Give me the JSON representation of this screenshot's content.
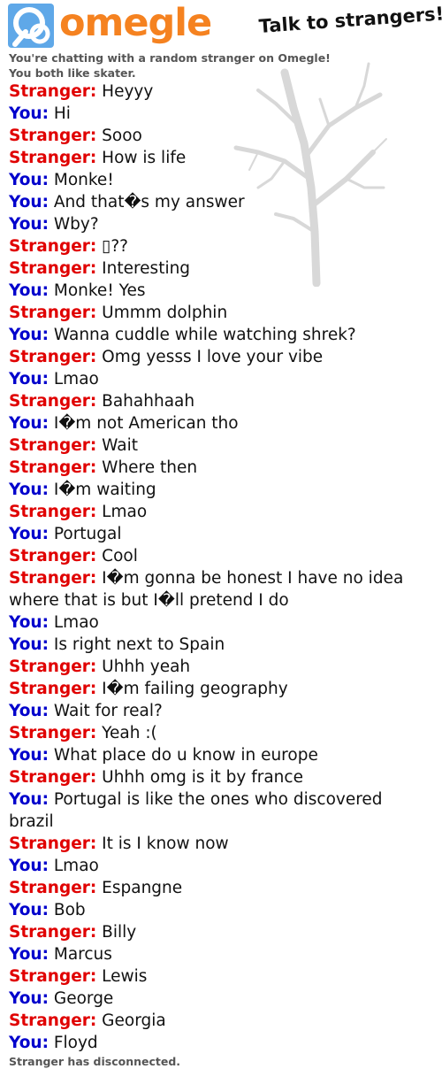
{
  "header": {
    "wordmark": "omegle",
    "tagline": "Talk to strangers!",
    "logo_icon": "omegle-logo-icon"
  },
  "intro": {
    "line1": "You're chatting with a random stranger on Omegle!",
    "line2": "You both like skater."
  },
  "colors": {
    "stranger": "#e00000",
    "you": "#0000cc",
    "brand": "#f58220",
    "logo_blue": "#5fa8e8"
  },
  "messages": [
    {
      "speaker": "Stranger:",
      "text": "Heyyy"
    },
    {
      "speaker": "You:",
      "text": "Hi"
    },
    {
      "speaker": "Stranger:",
      "text": "Sooo"
    },
    {
      "speaker": "Stranger:",
      "text": "How is life"
    },
    {
      "speaker": "You:",
      "text": "Monke!"
    },
    {
      "speaker": "You:",
      "text": "And that�s my answer"
    },
    {
      "speaker": "You:",
      "text": "Wby?"
    },
    {
      "speaker": "Stranger:",
      "text": "▯??"
    },
    {
      "speaker": "Stranger:",
      "text": "Interesting"
    },
    {
      "speaker": "You:",
      "text": "Monke! Yes"
    },
    {
      "speaker": "Stranger:",
      "text": "Ummm dolphin"
    },
    {
      "speaker": "You:",
      "text": "Wanna cuddle while watching shrek?"
    },
    {
      "speaker": "Stranger:",
      "text": "Omg yesss I love your vibe"
    },
    {
      "speaker": "You:",
      "text": "Lmao"
    },
    {
      "speaker": "Stranger:",
      "text": "Bahahhaah"
    },
    {
      "speaker": "You:",
      "text": "I�m not American tho"
    },
    {
      "speaker": "Stranger:",
      "text": "Wait"
    },
    {
      "speaker": "Stranger:",
      "text": "Where then"
    },
    {
      "speaker": "You:",
      "text": "I�m waiting"
    },
    {
      "speaker": "Stranger:",
      "text": "Lmao"
    },
    {
      "speaker": "You:",
      "text": "Portugal"
    },
    {
      "speaker": "Stranger:",
      "text": "Cool"
    },
    {
      "speaker": "Stranger:",
      "text": "I�m gonna be honest I have no idea where that is but I�ll pretend I do"
    },
    {
      "speaker": "You:",
      "text": "Lmao"
    },
    {
      "speaker": "You:",
      "text": "Is right next to Spain"
    },
    {
      "speaker": "Stranger:",
      "text": "Uhhh yeah"
    },
    {
      "speaker": "Stranger:",
      "text": "I�m failing geography"
    },
    {
      "speaker": "You:",
      "text": "Wait for real?"
    },
    {
      "speaker": "Stranger:",
      "text": "Yeah :("
    },
    {
      "speaker": "You:",
      "text": "What place do u know in europe"
    },
    {
      "speaker": "Stranger:",
      "text": "Uhhh omg is it by france"
    },
    {
      "speaker": "You:",
      "text": "Portugal is like the ones who discovered brazil"
    },
    {
      "speaker": "Stranger:",
      "text": "It is I know now"
    },
    {
      "speaker": "You:",
      "text": "Lmao"
    },
    {
      "speaker": "Stranger:",
      "text": "Espangne"
    },
    {
      "speaker": "You:",
      "text": "Bob"
    },
    {
      "speaker": "Stranger:",
      "text": "Billy"
    },
    {
      "speaker": "You:",
      "text": "Marcus"
    },
    {
      "speaker": "Stranger:",
      "text": "Lewis"
    },
    {
      "speaker": "You:",
      "text": "George"
    },
    {
      "speaker": "Stranger:",
      "text": "Georgia"
    },
    {
      "speaker": "You:",
      "text": "Floyd"
    }
  ],
  "status": "Stranger has disconnected."
}
